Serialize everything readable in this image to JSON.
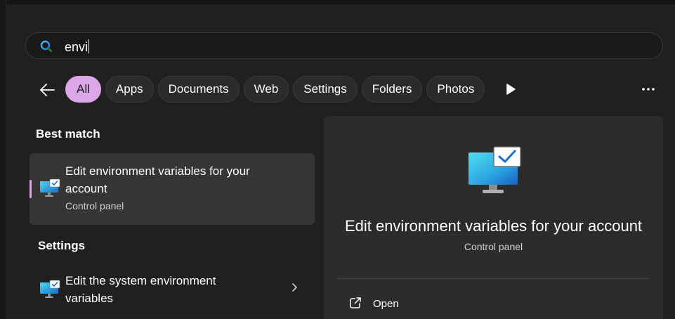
{
  "search": {
    "query": "envi"
  },
  "filters": [
    {
      "label": "All"
    },
    {
      "label": "Apps"
    },
    {
      "label": "Documents"
    },
    {
      "label": "Web"
    },
    {
      "label": "Settings"
    },
    {
      "label": "Folders"
    },
    {
      "label": "Photos"
    }
  ],
  "active_filter": "All",
  "best_match": {
    "heading": "Best match",
    "title_line1": "Edit environment variables for your",
    "title_line2": "account",
    "subtitle": "Control panel"
  },
  "settings_section": {
    "heading": "Settings",
    "title_line1": "Edit the system environment",
    "title_line2": "variables"
  },
  "preview": {
    "title": "Edit environment variables for your account",
    "subtitle": "Control panel",
    "actions": [
      {
        "label": "Open",
        "icon": "open-external-icon"
      }
    ]
  },
  "colors": {
    "accent": "#dba7e6",
    "panel": "#202020",
    "preview_panel": "#2c2c2c"
  },
  "icons": {
    "search": "search-icon",
    "back": "back-arrow-icon",
    "more_filters": "play-icon",
    "more": "more-options-icon",
    "result": "control-panel-monitor-icon",
    "chevron": "chevron-right-icon"
  }
}
